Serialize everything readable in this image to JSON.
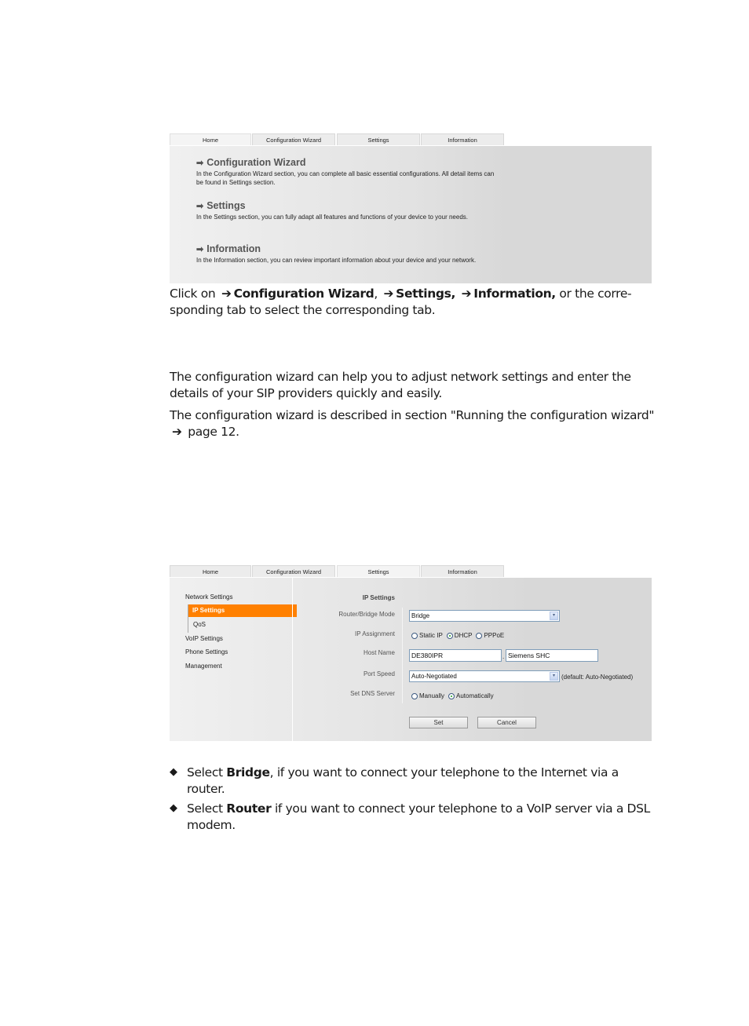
{
  "screenshot_home": {
    "tabs": [
      "Home",
      "Configuration Wizard",
      "Settings",
      "Information"
    ],
    "active_tab": "Home",
    "sections": [
      {
        "icon": "arrow-right-icon",
        "title": "Configuration Wizard",
        "text": "In the Configuration Wizard section, you can complete all basic essential configurations. All detail items can be found in Settings section."
      },
      {
        "icon": "arrow-right-icon",
        "title": "Settings",
        "text": "In the Settings section, you can fully adapt all features and functions of your device to your needs."
      },
      {
        "icon": "arrow-right-icon",
        "title": "Information",
        "text": "In the Information section, you can review important information about your device and your network."
      }
    ]
  },
  "paragraph_click": {
    "prefix": "Click on",
    "link1": "Configuration Wizard",
    "sep1": ",",
    "link2": "Settings,",
    "link3": "Information,",
    "suffix": "or the corre-sponding tab to select the corresponding tab."
  },
  "paragraph_wizard_1": "The configuration wizard can help you to adjust network settings and enter the details of your SIP providers quickly and easily.",
  "paragraph_wizard_2": {
    "text": "The configuration wizard is described in section \"Running the configuration wizard\"",
    "page_ref": "page 12."
  },
  "screenshot_settings": {
    "tabs": [
      "Home",
      "Configuration Wizard",
      "Settings",
      "Information"
    ],
    "active_tab": "Settings",
    "sidebar": {
      "items": [
        "Network Settings",
        "IP Settings",
        "QoS",
        "VoIP Settings",
        "Phone Settings",
        "Management"
      ],
      "active": "IP Settings"
    },
    "form": {
      "section_title": "IP Settings",
      "router_bridge_mode": {
        "label": "Router/Bridge Mode",
        "value": "Bridge"
      },
      "ip_assignment": {
        "label": "IP Assignment",
        "options": [
          "Static IP",
          "DHCP",
          "PPPoE"
        ],
        "selected": "DHCP"
      },
      "host_name": {
        "label": "Host Name",
        "value1": "DE380IPR",
        "separator": ".",
        "value2": "Siemens SHC"
      },
      "port_speed": {
        "label": "Port Speed",
        "value": "Auto-Negotiated",
        "hint": "(default: Auto-Negotiated)"
      },
      "dns_server": {
        "label": "Set DNS Server",
        "options": [
          "Manually",
          "Automatically"
        ],
        "selected": "Automatically"
      },
      "buttons": {
        "set": "Set",
        "cancel": "Cancel"
      }
    }
  },
  "bullets": [
    {
      "prefix": "Select",
      "bold": "Bridge",
      "text": ", if you want to connect your telephone to the Internet via a router."
    },
    {
      "prefix": "Select",
      "bold": "Router",
      "text": " if you want to connect your telephone to a VoIP server via a DSL modem."
    }
  ],
  "glyphs": {
    "arrow": "➔",
    "bullet": "◆",
    "home_arrow": "➡",
    "dropdown": "▾"
  }
}
